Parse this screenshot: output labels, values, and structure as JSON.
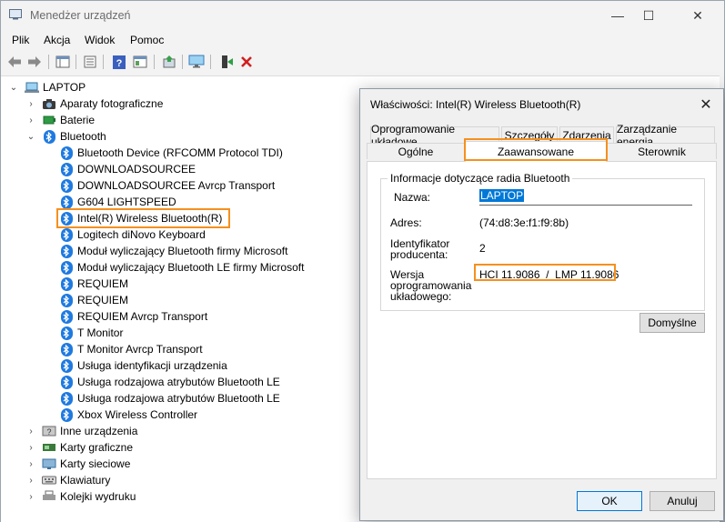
{
  "window": {
    "title": "Menedżer urządzeń",
    "controls": {
      "minimize": "—",
      "maximize": "☐",
      "close": "✕"
    }
  },
  "menu": [
    "Plik",
    "Akcja",
    "Widok",
    "Pomoc"
  ],
  "toolbar_icons": [
    "back-arrow-icon",
    "forward-arrow-icon",
    "properties-grid-icon",
    "list-view-icon",
    "help-icon",
    "properties-icon",
    "update-driver-icon",
    "monitor-icon",
    "enable-device-icon",
    "uninstall-x-icon"
  ],
  "tree": {
    "root": "LAPTOP",
    "categories_before": [
      {
        "label": "Aparaty fotograficzne",
        "icon": "camera-icon"
      },
      {
        "label": "Baterie",
        "icon": "battery-icon"
      }
    ],
    "bluetooth": {
      "label": "Bluetooth",
      "devices": [
        "Bluetooth Device (RFCOMM Protocol TDI)",
        "DOWNLOADSOURCEE",
        "DOWNLOADSOURCEE Avrcp Transport",
        "G604 LIGHTSPEED",
        "Intel(R) Wireless Bluetooth(R)",
        "Logitech diNovo Keyboard",
        "Moduł wyliczający Bluetooth firmy Microsoft",
        "Moduł wyliczający Bluetooth LE firmy Microsoft",
        "REQUIEM",
        "REQUIEM",
        "REQUIEM Avrcp Transport",
        "T Monitor",
        "T Monitor Avrcp Transport",
        "Usługa identyfikacji urządzenia",
        "Usługa rodzajowa atrybutów Bluetooth LE",
        "Usługa rodzajowa atrybutów Bluetooth LE",
        "Xbox Wireless Controller"
      ]
    },
    "categories_after": [
      {
        "label": "Inne urządzenia",
        "icon": "other-devices-icon"
      },
      {
        "label": "Karty graficzne",
        "icon": "display-adapter-icon"
      },
      {
        "label": "Karty sieciowe",
        "icon": "network-adapter-icon"
      },
      {
        "label": "Klawiatury",
        "icon": "keyboard-icon"
      },
      {
        "label": "Kolejki wydruku",
        "icon": "printer-icon"
      }
    ]
  },
  "dialog": {
    "title": "Właściwości: Intel(R) Wireless Bluetooth(R)",
    "tabs_row1": [
      "Oprogramowanie układowe",
      "Szczegóły",
      "Zdarzenia",
      "Zarządzanie energią"
    ],
    "tabs_row2": [
      "Ogólne",
      "Zaawansowane",
      "Sterownik"
    ],
    "group_label": "Informacje dotyczące radia Bluetooth",
    "name_label": "Nazwa:",
    "name_value": "LAPTOP",
    "address_label": "Adres:",
    "address_value": "(74:d8:3e:f1:f9:8b)",
    "manufacturer_label_1": "Identyfikator",
    "manufacturer_label_2": "producenta:",
    "manufacturer_value": "2",
    "firmware_label_1": "Wersja",
    "firmware_label_2": "oprogramowania",
    "firmware_label_3": "układowego:",
    "firmware_value": "HCI 11.9086  /  LMP 11.9086",
    "defaults_button": "Domyślne",
    "ok_button": "OK",
    "cancel_button": "Anuluj"
  },
  "colors": {
    "highlight": "#f5901e",
    "bluetooth": "#1f7ae0",
    "selection": "#0078d7"
  }
}
